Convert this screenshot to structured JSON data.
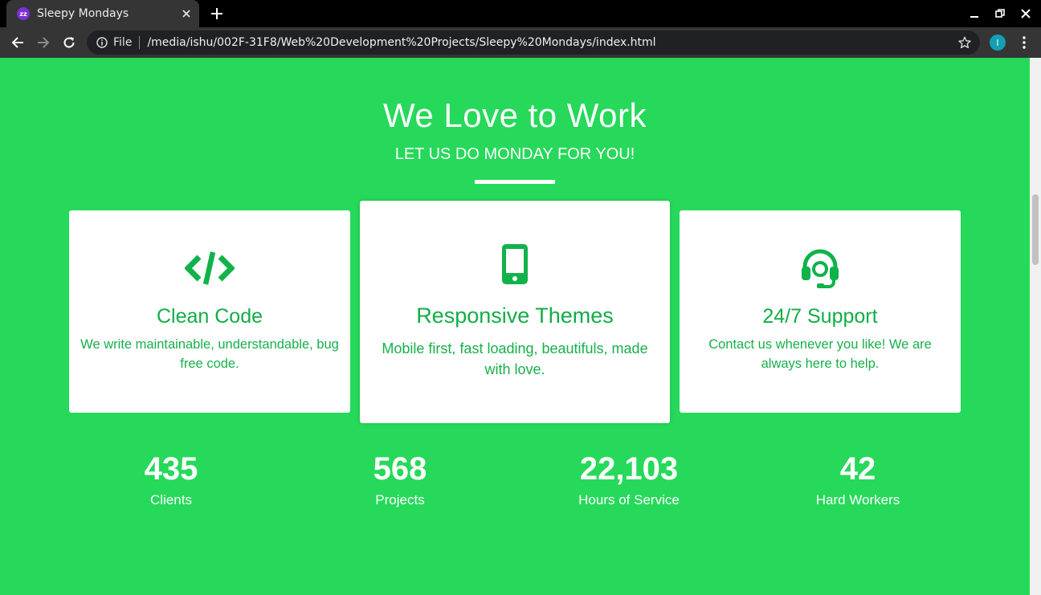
{
  "browser": {
    "tab_title": "Sleepy Mondays",
    "favicon_text": "zz",
    "scheme_label": "File",
    "url": "/media/ishu/002F-31F8/Web%20Development%20Projects/Sleepy%20Mondays/index.html",
    "profile_initial": "I",
    "colors": {
      "tabstrip": "#000000",
      "toolbar": "#353535",
      "omnibox": "#202124",
      "avatar": "#12a0b5"
    }
  },
  "section": {
    "heading": "We Love to Work",
    "subheading": "LET US DO MONDAY FOR YOU!",
    "background_color": "#26d95a",
    "accent_color": "#11b24a"
  },
  "cards": [
    {
      "icon": "code-icon",
      "title": "Clean Code",
      "text": "We write maintainable, understandable, bug free code."
    },
    {
      "icon": "mobile-icon",
      "title": "Responsive Themes",
      "text": "Mobile first, fast loading, beautifuls, made with love."
    },
    {
      "icon": "headset-icon",
      "title": "24/7 Support",
      "text": "Contact us whenever you like! We are always here to help."
    }
  ],
  "stats": [
    {
      "value": "435",
      "label": "Clients"
    },
    {
      "value": "568",
      "label": "Projects"
    },
    {
      "value": "22,103",
      "label": "Hours of Service"
    },
    {
      "value": "42",
      "label": "Hard Workers"
    }
  ]
}
